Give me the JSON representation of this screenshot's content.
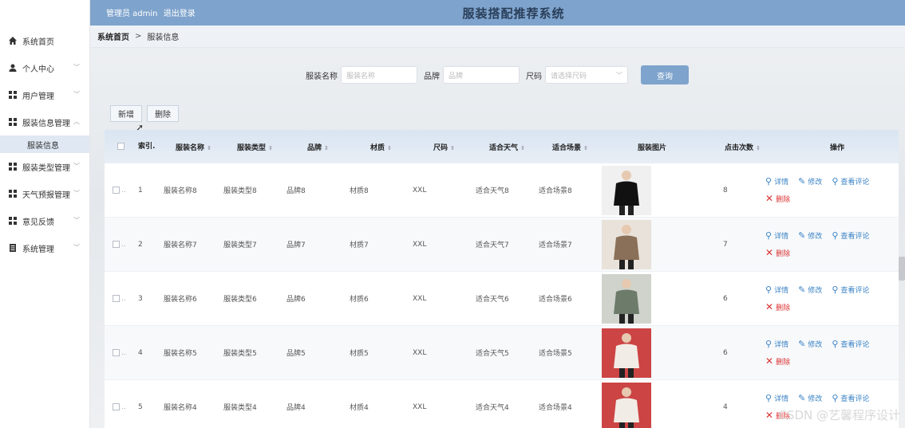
{
  "header": {
    "admin_label": "管理员 admin",
    "logout_label": "退出登录",
    "title": "服装搭配推荐系统"
  },
  "breadcrumb": {
    "home": "系统首页",
    "separator": ">",
    "current": "服装信息"
  },
  "sidebar": {
    "items": [
      {
        "label": "系统首页",
        "icon": "home-icon"
      },
      {
        "label": "个人中心",
        "icon": "user-icon",
        "expandable": true
      },
      {
        "label": "用户管理",
        "icon": "grid-icon",
        "expandable": true
      },
      {
        "label": "服装信息管理",
        "icon": "grid-icon",
        "expanded": true
      },
      {
        "label": "服装信息",
        "sub": true,
        "active": true
      },
      {
        "label": "服装类型管理",
        "icon": "grid-icon",
        "expandable": true
      },
      {
        "label": "天气预报管理",
        "icon": "grid-icon",
        "expandable": true
      },
      {
        "label": "意见反馈",
        "icon": "grid-icon",
        "expandable": true
      },
      {
        "label": "系统管理",
        "icon": "doc-icon",
        "expandable": true
      }
    ]
  },
  "search": {
    "name_label": "服装名称",
    "name_placeholder": "服装名称",
    "brand_label": "品牌",
    "brand_placeholder": "品牌",
    "size_label": "尺码",
    "size_placeholder": "请选择尺码",
    "query_button": "查询"
  },
  "toolbar": {
    "add_label": "新增",
    "delete_label": "删除"
  },
  "table": {
    "headers": {
      "index": "索引.",
      "name": "服装名称",
      "type": "服装类型",
      "brand": "品牌",
      "material": "材质",
      "size": "尺码",
      "weather": "适合天气",
      "scene": "适合场景",
      "image": "服装图片",
      "clicks": "点击次数",
      "actions": "操作"
    },
    "actions": {
      "detail": "详情",
      "edit": "修改",
      "comments": "查看评论",
      "delete": "删除"
    },
    "rows": [
      {
        "index": "1",
        "name": "服装名称8",
        "type": "服装类型8",
        "brand": "品牌8",
        "material": "材质8",
        "size": "XXL",
        "weather": "适合天气8",
        "scene": "适合场景8",
        "clicks": "8"
      },
      {
        "index": "2",
        "name": "服装名称7",
        "type": "服装类型7",
        "brand": "品牌7",
        "material": "材质7",
        "size": "XXL",
        "weather": "适合天气7",
        "scene": "适合场景7",
        "clicks": "7"
      },
      {
        "index": "3",
        "name": "服装名称6",
        "type": "服装类型6",
        "brand": "品牌6",
        "material": "材质6",
        "size": "XXL",
        "weather": "适合天气6",
        "scene": "适合场景6",
        "clicks": "6"
      },
      {
        "index": "4",
        "name": "服装名称5",
        "type": "服装类型5",
        "brand": "品牌5",
        "material": "材质5",
        "size": "XXL",
        "weather": "适合天气5",
        "scene": "适合场景5",
        "clicks": "6"
      },
      {
        "index": "5",
        "name": "服装名称4",
        "type": "服装类型4",
        "brand": "品牌4",
        "material": "材质4",
        "size": "XXL",
        "weather": "适合天气4",
        "scene": "适合场景4",
        "clicks": "4"
      }
    ]
  },
  "watermark": "CSDN @艺馨程序设计",
  "colors": {
    "header": "#7ea3cc",
    "link": "#3a82c4",
    "danger": "#d33"
  }
}
